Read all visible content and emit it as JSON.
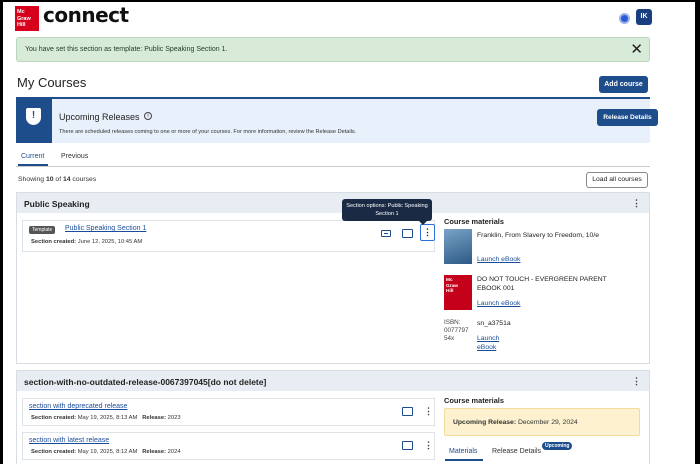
{
  "header": {
    "logo_lines": [
      "Mc",
      "Graw",
      "Hill"
    ],
    "brand": "connect",
    "avatar_initials": "IK"
  },
  "alert": {
    "message": "You have set this section as template: Public Speaking Section 1.",
    "close_icon": "close-icon"
  },
  "page": {
    "title": "My Courses",
    "add_course_label": "Add course"
  },
  "releases_banner": {
    "title": "Upcoming Releases",
    "info_glyph": "i",
    "message": "There are scheduled releases coming to one or more of your courses. For more information, review the Release Details.",
    "button_label": "Release Details",
    "icon": "shield-alert-icon"
  },
  "tabs": [
    {
      "label": "Current",
      "active": true
    },
    {
      "label": "Previous",
      "active": false
    }
  ],
  "summary": {
    "prefix": "Showing ",
    "shown": "10",
    "middle": " of ",
    "total": "14",
    "suffix": " courses",
    "load_all_label": "Load all courses"
  },
  "courses": [
    {
      "title": "Public Speaking",
      "sections": [
        {
          "badge": "Template",
          "name": "Public Speaking Section 1",
          "created_label": "Section created:",
          "created_value": " June 12, 2025, 10:45 AM",
          "tooltip": "Section options: Public Speaking Section 1"
        }
      ],
      "materials_heading": "Course materials",
      "materials": [
        {
          "title": "Franklin, From Slavery to Freedom, 10/e",
          "link": "Launch eBook"
        },
        {
          "title": "DO NOT TOUCH - EVERGREEN PARENT EBOOK 001",
          "link": "Launch eBook",
          "cover_lines": [
            "Mc",
            "Graw",
            "Hill"
          ]
        },
        {
          "isbn_text": "ISBN: 0077797 54x",
          "title": "sn_a3751a",
          "link_lines": [
            "Launch",
            "eBook"
          ]
        }
      ]
    },
    {
      "title": "section-with-no-outdated-release-0067397045[do not delete]",
      "sections": [
        {
          "name": "section with deprecated release",
          "created_label": "Section created:",
          "created_value": " May 19, 2025, 8:13 AM",
          "release_label": "Release:",
          "release_value": " 2023"
        },
        {
          "name": "section with latest release",
          "created_label": "Section created:",
          "created_value": " May 19, 2025, 8:12 AM",
          "release_label": "Release:",
          "release_value": " 2024"
        }
      ],
      "materials_heading": "Course materials",
      "upcoming_label": "Upcoming Release:",
      "upcoming_value": " December 29, 2024",
      "material_tabs": [
        "Materials",
        "Release Details"
      ],
      "material_tab_badge": "Upcoming"
    }
  ],
  "colors": {
    "brand_red": "#d6001c",
    "primary_blue": "#1e4d8c",
    "success_bg": "#d8ebd9",
    "warning_bg": "#fdf1cf"
  }
}
